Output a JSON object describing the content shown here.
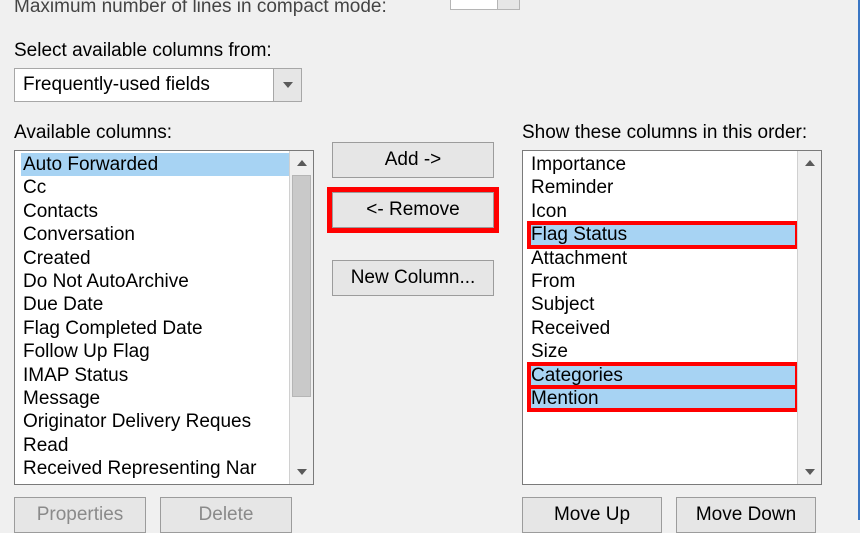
{
  "topCut": "Maximum number of lines in compact mode:",
  "selectLabel": "Select available columns from:",
  "comboValue": "Frequently-used fields",
  "availableLabel": "Available columns:",
  "orderLabel": "Show these columns in this order:",
  "buttons": {
    "add": "Add ->",
    "remove": "<- Remove",
    "newColumn": "New Column...",
    "properties": "Properties",
    "delete": "Delete",
    "moveUp": "Move Up",
    "moveDown": "Move Down"
  },
  "available": [
    "Auto Forwarded",
    "Cc",
    "Contacts",
    "Conversation",
    "Created",
    "Do Not AutoArchive",
    "Due Date",
    "Flag Completed Date",
    "Follow Up Flag",
    "IMAP Status",
    "Message",
    "Originator Delivery Reques",
    "Read",
    "Received Representing Nar"
  ],
  "shown": [
    "Importance",
    "Reminder",
    "Icon",
    "Flag Status",
    "Attachment",
    "From",
    "Subject",
    "Received",
    "Size",
    "Categories",
    "Mention"
  ],
  "availableSelectedIndex": 0,
  "shownHighlightIndices": [
    3,
    9,
    10
  ],
  "shownDottedIndex": 9
}
